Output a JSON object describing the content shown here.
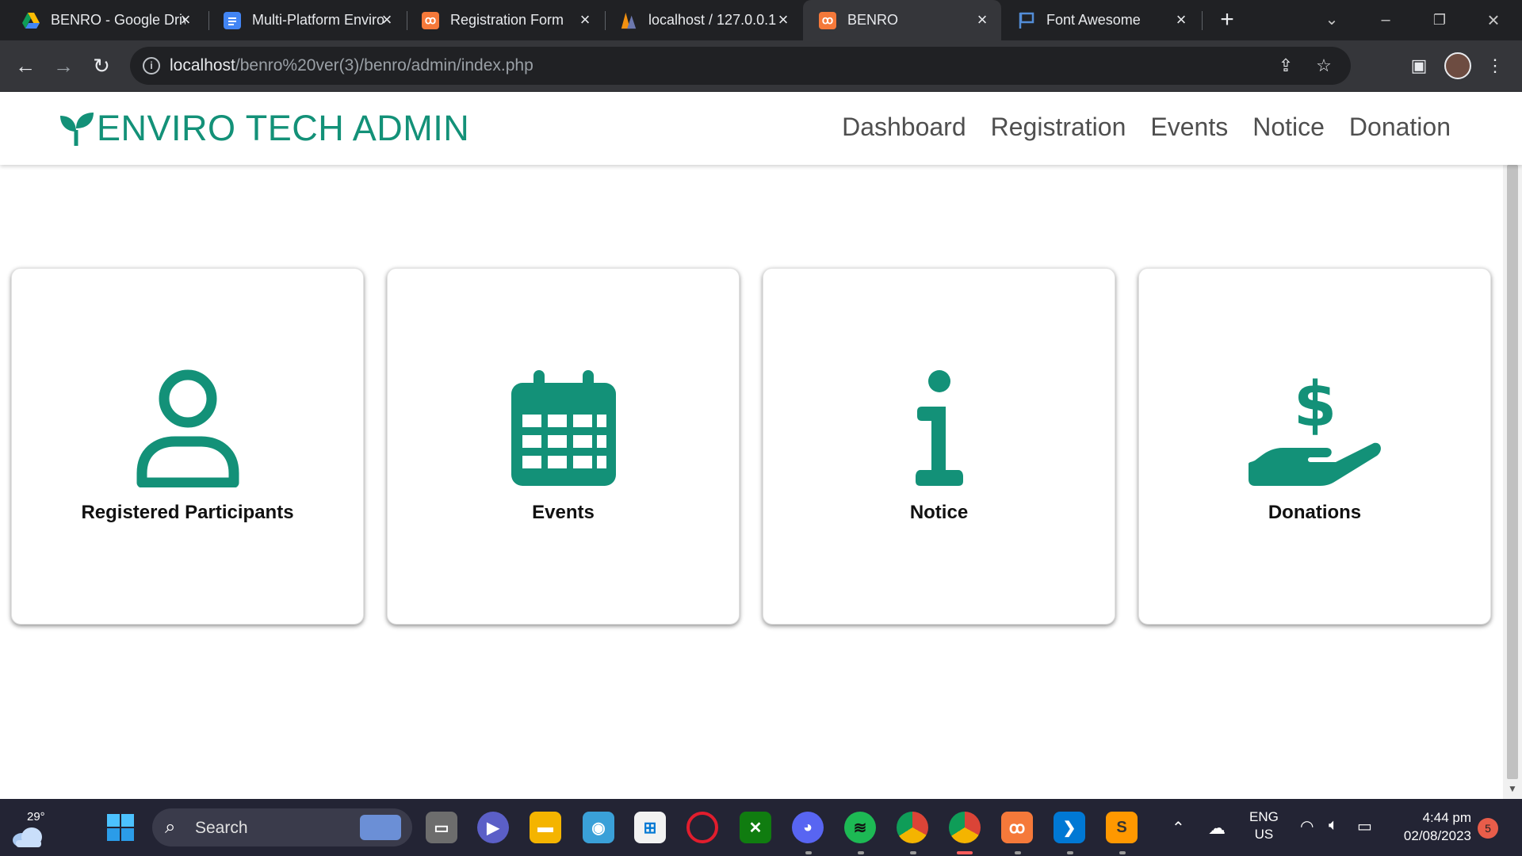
{
  "browser": {
    "tabs": [
      {
        "title": "BENRO - Google Drive",
        "favicon": "google-drive-icon",
        "active": false
      },
      {
        "title": "Multi-Platform Enviro",
        "favicon": "google-docs-icon",
        "active": false
      },
      {
        "title": "Registration Form",
        "favicon": "xampp-icon",
        "active": false
      },
      {
        "title": "localhost / 127.0.0.1",
        "favicon": "phpmyadmin-icon",
        "active": false
      },
      {
        "title": "BENRO",
        "favicon": "xampp-icon",
        "active": true
      },
      {
        "title": "Font Awesome",
        "favicon": "font-awesome-flag-icon",
        "active": false
      }
    ],
    "url_host": "localhost",
    "url_path": "/benro%20ver(3)/benro/admin/index.php"
  },
  "site": {
    "brand": "ENVIRO TECH ADMIN",
    "brand_color": "#139178",
    "nav": [
      "Dashboard",
      "Registration",
      "Events",
      "Notice",
      "Donation"
    ]
  },
  "cards": [
    {
      "label": "Registered Participants",
      "icon": "user-icon"
    },
    {
      "label": "Events",
      "icon": "calendar-icon"
    },
    {
      "label": "Notice",
      "icon": "info-icon"
    },
    {
      "label": "Donations",
      "icon": "hand-holding-dollar-icon"
    }
  ],
  "taskbar": {
    "temperature": "29°",
    "search_placeholder": "Search",
    "language": "ENG",
    "region": "US",
    "time": "4:44 pm",
    "date": "02/08/2023",
    "notification_count": "5"
  }
}
